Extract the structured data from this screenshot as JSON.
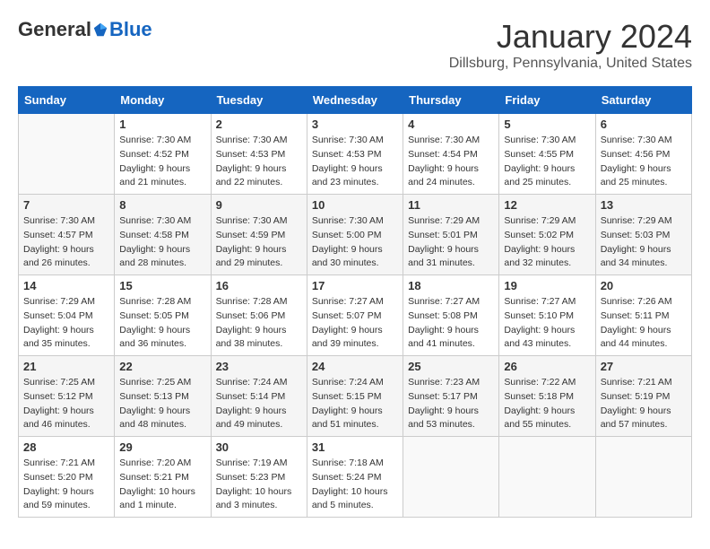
{
  "header": {
    "logo": {
      "general": "General",
      "blue": "Blue"
    },
    "title": "January 2024",
    "location": "Dillsburg, Pennsylvania, United States"
  },
  "days_of_week": [
    "Sunday",
    "Monday",
    "Tuesday",
    "Wednesday",
    "Thursday",
    "Friday",
    "Saturday"
  ],
  "weeks": [
    [
      {
        "day": "",
        "details": ""
      },
      {
        "day": "1",
        "details": "Sunrise: 7:30 AM\nSunset: 4:52 PM\nDaylight: 9 hours\nand 21 minutes."
      },
      {
        "day": "2",
        "details": "Sunrise: 7:30 AM\nSunset: 4:53 PM\nDaylight: 9 hours\nand 22 minutes."
      },
      {
        "day": "3",
        "details": "Sunrise: 7:30 AM\nSunset: 4:53 PM\nDaylight: 9 hours\nand 23 minutes."
      },
      {
        "day": "4",
        "details": "Sunrise: 7:30 AM\nSunset: 4:54 PM\nDaylight: 9 hours\nand 24 minutes."
      },
      {
        "day": "5",
        "details": "Sunrise: 7:30 AM\nSunset: 4:55 PM\nDaylight: 9 hours\nand 25 minutes."
      },
      {
        "day": "6",
        "details": "Sunrise: 7:30 AM\nSunset: 4:56 PM\nDaylight: 9 hours\nand 25 minutes."
      }
    ],
    [
      {
        "day": "7",
        "details": "Sunrise: 7:30 AM\nSunset: 4:57 PM\nDaylight: 9 hours\nand 26 minutes."
      },
      {
        "day": "8",
        "details": "Sunrise: 7:30 AM\nSunset: 4:58 PM\nDaylight: 9 hours\nand 28 minutes."
      },
      {
        "day": "9",
        "details": "Sunrise: 7:30 AM\nSunset: 4:59 PM\nDaylight: 9 hours\nand 29 minutes."
      },
      {
        "day": "10",
        "details": "Sunrise: 7:30 AM\nSunset: 5:00 PM\nDaylight: 9 hours\nand 30 minutes."
      },
      {
        "day": "11",
        "details": "Sunrise: 7:29 AM\nSunset: 5:01 PM\nDaylight: 9 hours\nand 31 minutes."
      },
      {
        "day": "12",
        "details": "Sunrise: 7:29 AM\nSunset: 5:02 PM\nDaylight: 9 hours\nand 32 minutes."
      },
      {
        "day": "13",
        "details": "Sunrise: 7:29 AM\nSunset: 5:03 PM\nDaylight: 9 hours\nand 34 minutes."
      }
    ],
    [
      {
        "day": "14",
        "details": "Sunrise: 7:29 AM\nSunset: 5:04 PM\nDaylight: 9 hours\nand 35 minutes."
      },
      {
        "day": "15",
        "details": "Sunrise: 7:28 AM\nSunset: 5:05 PM\nDaylight: 9 hours\nand 36 minutes."
      },
      {
        "day": "16",
        "details": "Sunrise: 7:28 AM\nSunset: 5:06 PM\nDaylight: 9 hours\nand 38 minutes."
      },
      {
        "day": "17",
        "details": "Sunrise: 7:27 AM\nSunset: 5:07 PM\nDaylight: 9 hours\nand 39 minutes."
      },
      {
        "day": "18",
        "details": "Sunrise: 7:27 AM\nSunset: 5:08 PM\nDaylight: 9 hours\nand 41 minutes."
      },
      {
        "day": "19",
        "details": "Sunrise: 7:27 AM\nSunset: 5:10 PM\nDaylight: 9 hours\nand 43 minutes."
      },
      {
        "day": "20",
        "details": "Sunrise: 7:26 AM\nSunset: 5:11 PM\nDaylight: 9 hours\nand 44 minutes."
      }
    ],
    [
      {
        "day": "21",
        "details": "Sunrise: 7:25 AM\nSunset: 5:12 PM\nDaylight: 9 hours\nand 46 minutes."
      },
      {
        "day": "22",
        "details": "Sunrise: 7:25 AM\nSunset: 5:13 PM\nDaylight: 9 hours\nand 48 minutes."
      },
      {
        "day": "23",
        "details": "Sunrise: 7:24 AM\nSunset: 5:14 PM\nDaylight: 9 hours\nand 49 minutes."
      },
      {
        "day": "24",
        "details": "Sunrise: 7:24 AM\nSunset: 5:15 PM\nDaylight: 9 hours\nand 51 minutes."
      },
      {
        "day": "25",
        "details": "Sunrise: 7:23 AM\nSunset: 5:17 PM\nDaylight: 9 hours\nand 53 minutes."
      },
      {
        "day": "26",
        "details": "Sunrise: 7:22 AM\nSunset: 5:18 PM\nDaylight: 9 hours\nand 55 minutes."
      },
      {
        "day": "27",
        "details": "Sunrise: 7:21 AM\nSunset: 5:19 PM\nDaylight: 9 hours\nand 57 minutes."
      }
    ],
    [
      {
        "day": "28",
        "details": "Sunrise: 7:21 AM\nSunset: 5:20 PM\nDaylight: 9 hours\nand 59 minutes."
      },
      {
        "day": "29",
        "details": "Sunrise: 7:20 AM\nSunset: 5:21 PM\nDaylight: 10 hours\nand 1 minute."
      },
      {
        "day": "30",
        "details": "Sunrise: 7:19 AM\nSunset: 5:23 PM\nDaylight: 10 hours\nand 3 minutes."
      },
      {
        "day": "31",
        "details": "Sunrise: 7:18 AM\nSunset: 5:24 PM\nDaylight: 10 hours\nand 5 minutes."
      },
      {
        "day": "",
        "details": ""
      },
      {
        "day": "",
        "details": ""
      },
      {
        "day": "",
        "details": ""
      }
    ]
  ]
}
